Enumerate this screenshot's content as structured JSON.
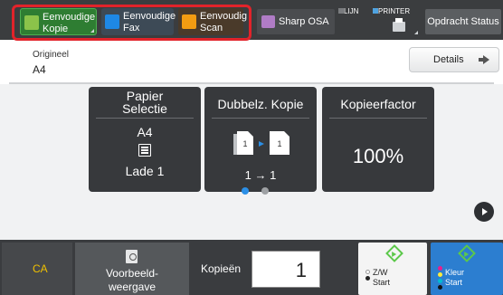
{
  "header": {
    "mode_tabs": [
      {
        "label_line1": "Eenvoudige",
        "label_line2": "Kopie",
        "icon": "copy-icon",
        "color": "#8bc34a"
      },
      {
        "label_line1": "Eenvoudige",
        "label_line2": "Fax",
        "icon": "fax-icon",
        "color": "#1e88e5"
      },
      {
        "label_line1": "Eenvoudig",
        "label_line2": "Scan",
        "icon": "scan-icon",
        "color": "#f39c12"
      }
    ],
    "sharp_osa": {
      "label": "Sharp OSA",
      "icon": "osa-icon"
    },
    "status": {
      "line": "LIJN",
      "printer": "PRINTER"
    },
    "job_status_label": "Opdracht Status"
  },
  "original": {
    "label": "Origineel",
    "value": "A4",
    "details_label": "Details"
  },
  "cards": {
    "paper": {
      "title_line1": "Papier",
      "title_line2": "Selectie",
      "size": "A4",
      "tray": "Lade 1"
    },
    "duplex": {
      "title": "Dubbelz. Kopie",
      "page1": "1",
      "page2": "1",
      "sides": "1 → 1"
    },
    "ratio": {
      "title": "Kopieerfactor",
      "value": "100%"
    }
  },
  "pager": {
    "pages": 2,
    "current": 1
  },
  "footer": {
    "ca_label": "CA",
    "preview_line1": "Voorbeeld-",
    "preview_line2": "weergave",
    "copies_label": "Kopieën",
    "copies_value": "1",
    "bw_start_line1": "Z/W",
    "bw_start_line2": "Start",
    "color_start_line1": "Kleur",
    "color_start_line2": "Start"
  },
  "colors": {
    "highlight": "#e2232a",
    "accent_blue": "#2c7ed0",
    "start_green": "#5cc84a",
    "ca_yellow": "#f0c000"
  }
}
